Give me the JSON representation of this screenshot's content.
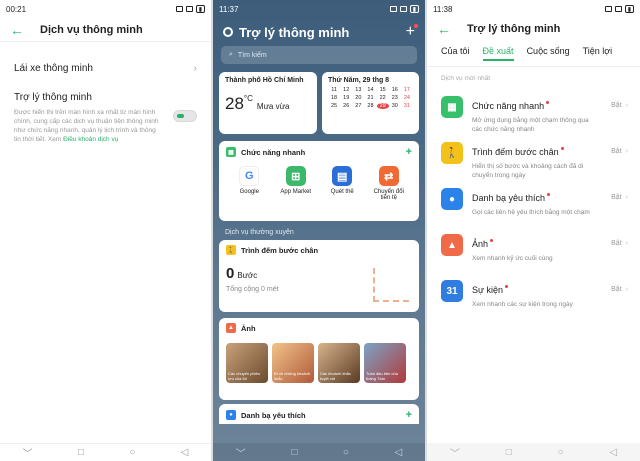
{
  "screen1": {
    "status_time": "00:21",
    "title": "Dịch vụ thông minh",
    "row1_label": "Lái xe thông minh",
    "section_label": "Trợ lý thông minh",
    "desc": "Được hiển thị trên màn hình xa nhất từ màn hình chính, cung cấp các dịch vụ thuận tiện thông minh như chức năng nhanh, quản lý lịch trình và thông tin thời tiết. Xem ",
    "desc_link": "Điều khoản dịch vụ"
  },
  "screen2": {
    "status_time": "11:37",
    "title": "Trợ lý thông minh",
    "search_placeholder": "Tìm kiếm",
    "weather_city": "Thành phố Hồ Chí Minh",
    "weather_temp": "28",
    "weather_unit": "°C",
    "weather_cond": "Mưa vừa",
    "calendar_date": "Thứ Năm, 29 thg 8",
    "calendar_days": [
      "11",
      "12",
      "13",
      "14",
      "15",
      "16",
      "17",
      "18",
      "19",
      "20",
      "21",
      "22",
      "23",
      "24",
      "25",
      "26",
      "27",
      "28",
      "29",
      "30",
      "31"
    ],
    "quick_title": "Chức năng nhanh",
    "apps": [
      "Google",
      "App Market",
      "Quét thẻ",
      "Chuyển đổi tiền tệ"
    ],
    "section_frequent": "Dịch vụ thường xuyên",
    "steps_title": "Trình đếm bước chân",
    "steps_value": "0",
    "steps_unit": "Bước",
    "steps_total": "Tổng cộng 0 mét",
    "photos_title": "Ảnh",
    "thumb_captions": [
      "Các chuyến phiêu lưu của tôi",
      "Đi về những khoảnh khắc",
      "Các khoảnh khắc tuyệt vời",
      "Tuần đầu tiên của tháng Tám"
    ],
    "fav_title": "Danh bạ yêu thích"
  },
  "screen3": {
    "status_time": "11:38",
    "title": "Trợ lý thông minh",
    "tabs": [
      "Của tôi",
      "Đề xuất",
      "Cuộc sống",
      "Tiện lợi"
    ],
    "active_tab_index": 1,
    "sub_label": "Dịch vụ mới nhất",
    "features": [
      {
        "name": "Chức năng nhanh",
        "desc": "Mở ứng dụng bằng một chạm thông qua các chức năng nhanh",
        "toggle": "Bật",
        "icon": "grid-icon",
        "color": "#37c06b"
      },
      {
        "name": "Trình đếm bước chân",
        "desc": "Hiển thị số bước và khoảng cách đã di chuyển trong ngày",
        "toggle": "Bật",
        "icon": "walk-icon",
        "color": "#f2c21a"
      },
      {
        "name": "Danh bạ yêu thích",
        "desc": "Gọi các liên hệ yêu thích bằng một chạm",
        "toggle": "Bật",
        "icon": "person-icon",
        "color": "#2b82e8"
      },
      {
        "name": "Ảnh",
        "desc": "Xem nhanh kỷ ức cuối cùng",
        "toggle": "Bật",
        "icon": "photo-icon",
        "color": "#f06a4a"
      },
      {
        "name": "Sự kiện",
        "desc": "Xem nhanh các sự kiện trong ngày",
        "toggle": "Bật",
        "icon": "calendar-icon",
        "color": "#2f7de0"
      }
    ]
  },
  "colors": {
    "accent": "#27b36a",
    "alert": "#e24545"
  }
}
